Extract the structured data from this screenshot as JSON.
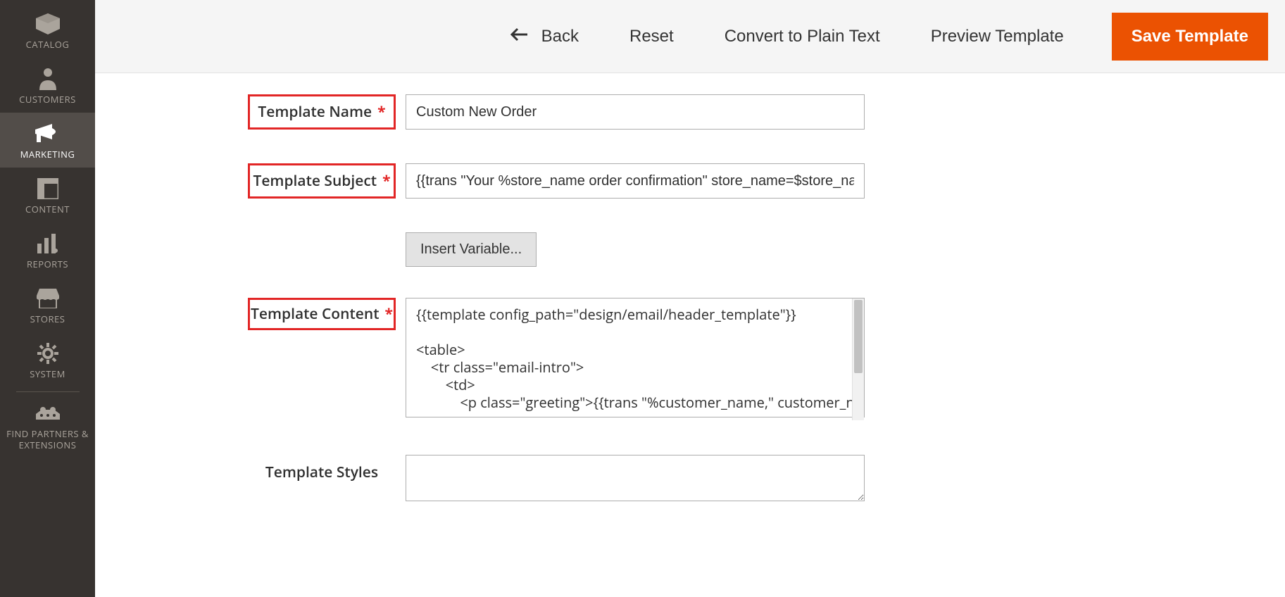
{
  "sidebar": {
    "items": [
      {
        "label": "CATALOG",
        "icon": "catalog"
      },
      {
        "label": "CUSTOMERS",
        "icon": "customers"
      },
      {
        "label": "MARKETING",
        "icon": "marketing",
        "active": true
      },
      {
        "label": "CONTENT",
        "icon": "content"
      },
      {
        "label": "REPORTS",
        "icon": "reports"
      },
      {
        "label": "STORES",
        "icon": "stores"
      },
      {
        "label": "SYSTEM",
        "icon": "system"
      },
      {
        "label": "FIND PARTNERS & EXTENSIONS",
        "icon": "partners"
      }
    ]
  },
  "actions": {
    "back": "Back",
    "reset": "Reset",
    "convert": "Convert to Plain Text",
    "preview": "Preview Template",
    "save": "Save Template"
  },
  "form": {
    "name_label": "Template Name",
    "name_value": "Custom New Order",
    "subject_label": "Template Subject",
    "subject_value": "{{trans \"Your %store_name order confirmation\" store_name=$store_name}}",
    "insert_variable": "Insert Variable...",
    "content_label": "Template Content",
    "content_value": "{{template config_path=\"design/email/header_template\"}}\n\n<table>\n    <tr class=\"email-intro\">\n        <td>\n            <p class=\"greeting\">{{trans \"%customer_name,\" customer_name=$order.getCustomerName()}}</p>",
    "styles_label": "Template Styles",
    "styles_value": ""
  }
}
